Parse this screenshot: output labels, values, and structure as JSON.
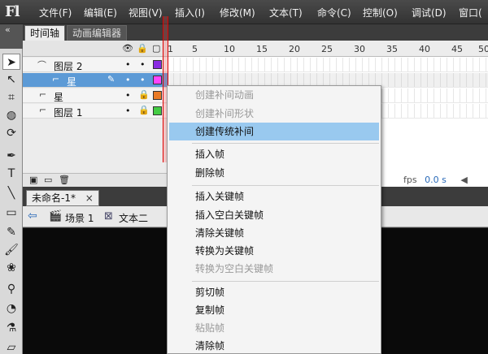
{
  "app": {
    "logo": "Fl"
  },
  "menubar": {
    "items": [
      "文件(F)",
      "编辑(E)",
      "视图(V)",
      "插入(I)",
      "修改(M)",
      "文本(T)",
      "命令(C)",
      "控制(O)",
      "调试(D)",
      "窗口("
    ]
  },
  "tools": {
    "collapse_label": "«"
  },
  "panel": {
    "tabs": [
      "时间轴",
      "动画编辑器"
    ],
    "layers": [
      {
        "name": "图层 2",
        "color": "#8a2be2"
      },
      {
        "name": "星",
        "color": "#ff44ff"
      },
      {
        "name": "星",
        "color": "#e97a26"
      },
      {
        "name": "图层 1",
        "color": "#44cc44"
      }
    ],
    "ruler": [
      "1",
      "5",
      "10",
      "15",
      "20",
      "25",
      "30",
      "35",
      "40",
      "45",
      "50"
    ],
    "fps": "fps",
    "time": "0.0 s"
  },
  "document": {
    "tab_label": "未命名-1*",
    "close": "×"
  },
  "breadcrumb": {
    "scene": "场景 1",
    "symbol": "文本二"
  },
  "context_menu": {
    "items": [
      {
        "label": "创建补间动画",
        "state": "disabled"
      },
      {
        "label": "创建补间形状",
        "state": "disabled"
      },
      {
        "label": "创建传统补间",
        "state": "highlight"
      },
      {
        "label": "插入帧",
        "state": "normal"
      },
      {
        "label": "删除帧",
        "state": "normal"
      },
      {
        "label": "插入关键帧",
        "state": "normal"
      },
      {
        "label": "插入空白关键帧",
        "state": "normal"
      },
      {
        "label": "清除关键帧",
        "state": "normal"
      },
      {
        "label": "转换为关键帧",
        "state": "normal"
      },
      {
        "label": "转换为空白关键帧",
        "state": "disabled"
      },
      {
        "label": "剪切帧",
        "state": "normal"
      },
      {
        "label": "复制帧",
        "state": "normal"
      },
      {
        "label": "粘贴帧",
        "state": "disabled"
      },
      {
        "label": "清除帧",
        "state": "normal"
      }
    ]
  }
}
